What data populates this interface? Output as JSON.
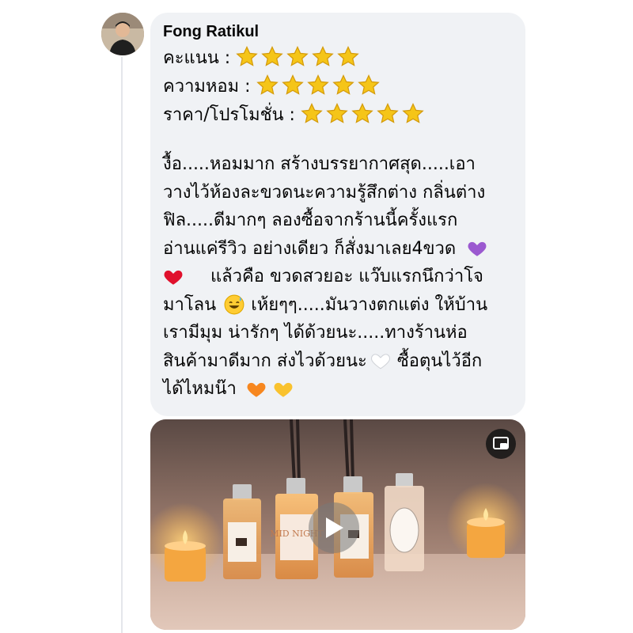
{
  "comment": {
    "author": "Fong Ratikul",
    "ratings": [
      {
        "label": "คะแนน :",
        "stars": 5
      },
      {
        "label": "ความหอม :",
        "stars": 5
      },
      {
        "label": "ราคา/โปรโมชั่น :",
        "stars": 5
      }
    ],
    "review_lines": [
      "งื้อ.....หอมมาก สร้างบรรยากาศสุด.....เอา",
      "วางไว้ห้องละขวดนะความรู้สึกต่าง กลิ่นต่าง",
      "ฟิล.....ดีมากๆ ลองซื้อจากร้านนี้ครั้งแรก",
      "อ่านแค่รีวิว อย่างเดียว ก็สั่งมาเลย4ขวด",
      "แล้วคือ ขวดสวยอะ แว๊บแรกนึกว่าโจ",
      "มาโลน",
      "เห้ยๆๆ.....มันวางตกแต่ง ให้บ้าน",
      "เรามีมุม น่ารักๆ ได้ด้วยนะ.....ทางร้านห่อ",
      "สินค้ามาดีมาก ส่งไวด้วยนะ",
      "ซื้อตุนไว้อีก",
      "ได้ไหมน๊า"
    ],
    "emoji": {
      "purple_heart": "purple-heart-icon",
      "red_heart": "red-heart-icon",
      "sweat_smile": "sweat-smile-icon",
      "white_heart": "white-heart-icon",
      "orange_heart": "orange-heart-icon",
      "yellow_heart": "yellow-heart-icon"
    },
    "bottle_label_text": "MID NIGHT"
  },
  "colors": {
    "bubble": "#f0f2f5",
    "text": "#050505",
    "star": "#f5c518"
  }
}
